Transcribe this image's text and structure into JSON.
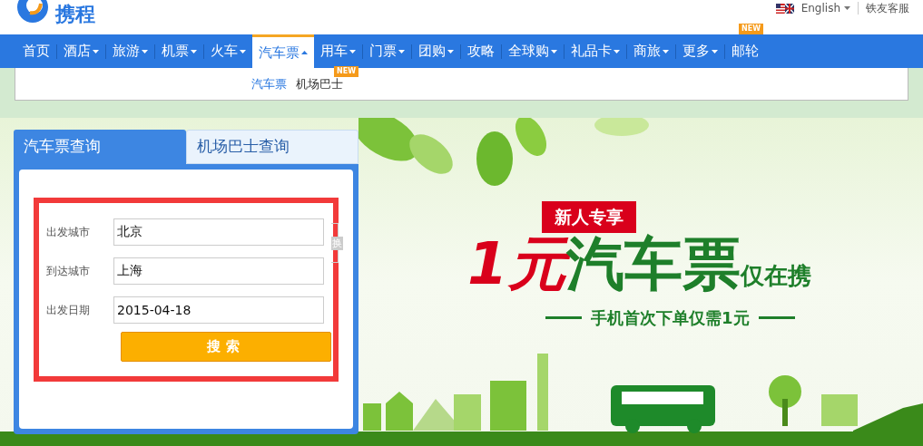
{
  "logo": {
    "text": "携程"
  },
  "top_links": {
    "language": "English",
    "service": "铁友客服"
  },
  "nav": [
    {
      "label": "首页",
      "dropdown": false,
      "selected": false
    },
    {
      "label": "酒店",
      "dropdown": true,
      "selected": false
    },
    {
      "label": "旅游",
      "dropdown": true,
      "selected": false
    },
    {
      "label": "机票",
      "dropdown": true,
      "selected": false
    },
    {
      "label": "火车",
      "dropdown": true,
      "selected": false
    },
    {
      "label": "汽车票",
      "dropdown": true,
      "selected": true
    },
    {
      "label": "用车",
      "dropdown": true,
      "selected": false
    },
    {
      "label": "门票",
      "dropdown": true,
      "selected": false
    },
    {
      "label": "团购",
      "dropdown": true,
      "selected": false
    },
    {
      "label": "攻略",
      "dropdown": false,
      "selected": false
    },
    {
      "label": "全球购",
      "dropdown": true,
      "selected": false
    },
    {
      "label": "礼品卡",
      "dropdown": true,
      "selected": false
    },
    {
      "label": "商旅",
      "dropdown": true,
      "selected": false
    },
    {
      "label": "更多",
      "dropdown": true,
      "selected": false
    },
    {
      "label": "邮轮",
      "dropdown": false,
      "selected": false,
      "badge": "NEW"
    }
  ],
  "subnav": [
    {
      "label": "汽车票",
      "selected": true
    },
    {
      "label": "机场巴士",
      "selected": false,
      "badge": "NEW"
    }
  ],
  "search_panel": {
    "tabs": [
      {
        "label": "汽车票查询",
        "selected": true
      },
      {
        "label": "机场巴士查询",
        "selected": false
      }
    ],
    "fields": [
      {
        "label": "出发城市",
        "value": "北京"
      },
      {
        "label": "到达城市",
        "value": "上海"
      },
      {
        "label": "出发日期",
        "value": "2015-04-18"
      }
    ],
    "swap": "换",
    "button": "搜索"
  },
  "banner": {
    "tag": "新人专享",
    "headline_red": "1元",
    "headline_green": "汽车票",
    "headline_small": "仅在携",
    "subline": "手机首次下单仅需1元"
  }
}
